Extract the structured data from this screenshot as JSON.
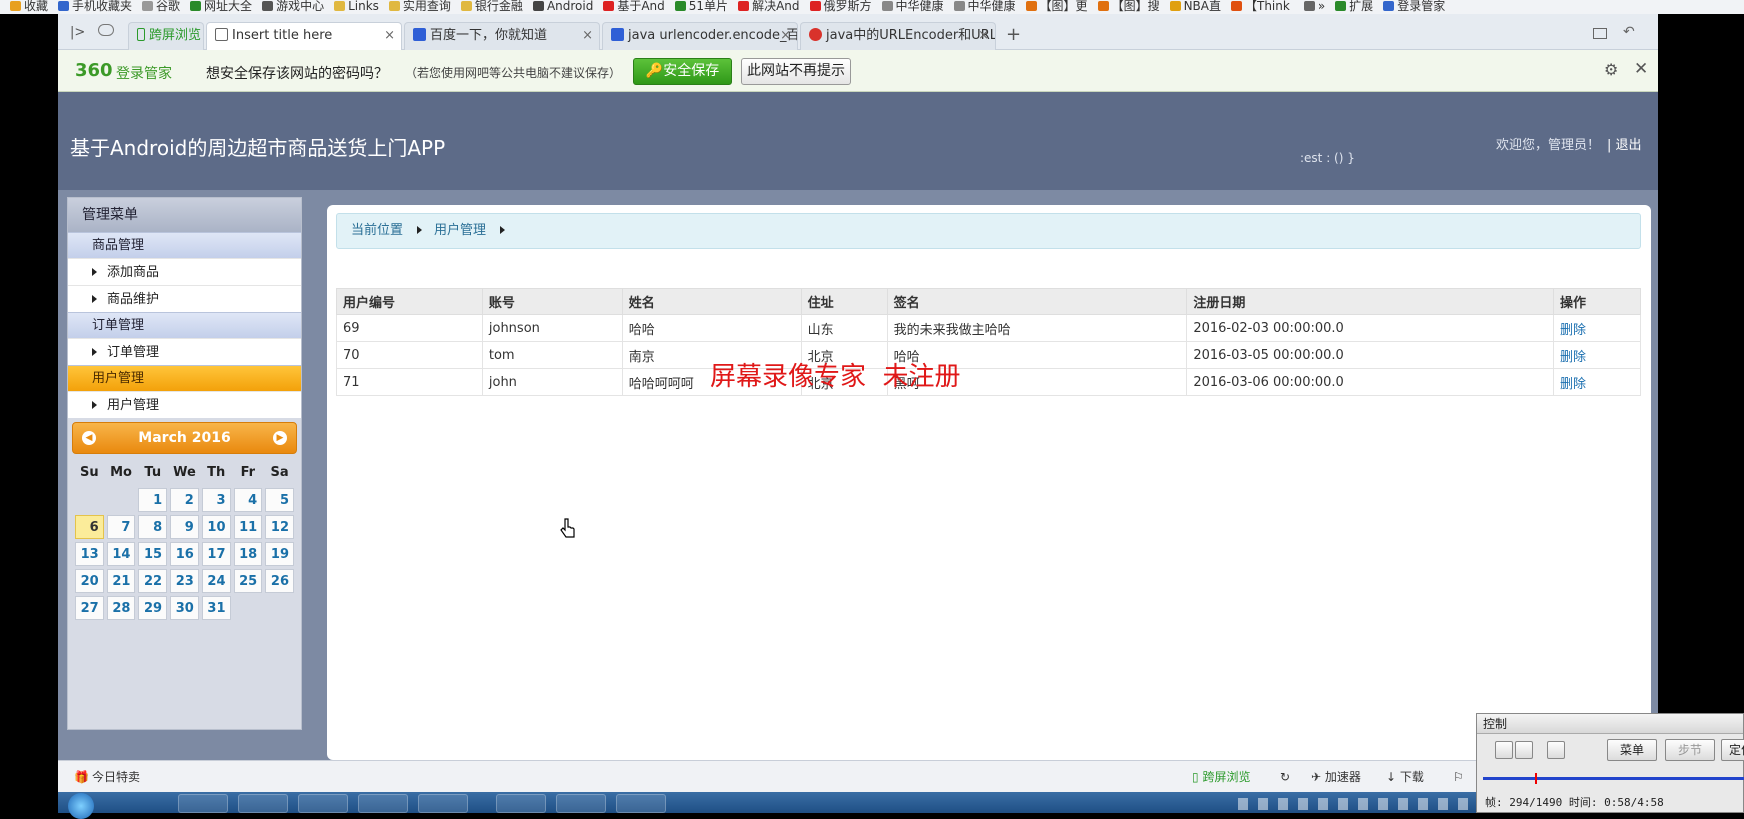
{
  "bookmarks": [
    "收藏",
    "手机收藏夹",
    "谷歌",
    "网址大全",
    "游戏中心",
    "Links",
    "实用查询",
    "银行金融",
    "Android",
    "基于And",
    "51单片",
    "解决And",
    "俄罗斯方",
    "中华健康",
    "中华健康",
    "【图】更",
    "【图】搜",
    "NBA直",
    "【Think",
    "»",
    "扩展",
    "登录管家"
  ],
  "tabs": [
    {
      "label": "跨屏浏览"
    },
    {
      "label": "Insert title here",
      "close": "×"
    },
    {
      "label": "百度一下，你就知道",
      "close": "×"
    },
    {
      "label": "java urlencoder.encode_百度",
      "close": "×"
    },
    {
      "label": "java中的URLEncoder和URLD",
      "close": "×"
    }
  ],
  "new_tab": "+",
  "password_bar": {
    "brand": "360",
    "brand_suffix": "登录管家",
    "prompt": "想安全保存该网站的密码吗？",
    "hint": "（若您使用网吧等公共电脑不建议保存）",
    "save_label": "安全保存",
    "never_label": "此网站不再提示"
  },
  "app": {
    "title": "基于Android的周边超市商品送货上门APP",
    "welcome": "欢迎您，管理员！",
    "logout": "| 退出",
    "debug_text": ":est : () }"
  },
  "menu": {
    "title": "管理菜单",
    "groups": [
      {
        "label": "商品管理",
        "items": [
          "添加商品",
          "商品维护"
        ]
      },
      {
        "label": "订单管理",
        "items": [
          "订单管理"
        ]
      },
      {
        "label": "用户管理",
        "items": [
          "用户管理"
        ]
      }
    ]
  },
  "calendar": {
    "title": "March 2016",
    "weekdays": [
      "Su",
      "Mo",
      "Tu",
      "We",
      "Th",
      "Fr",
      "Sa"
    ],
    "today": 6,
    "weeks": [
      [
        "",
        "",
        1,
        2,
        3,
        4,
        5
      ],
      [
        6,
        7,
        8,
        9,
        10,
        11,
        12
      ],
      [
        13,
        14,
        15,
        16,
        17,
        18,
        19
      ],
      [
        20,
        21,
        22,
        23,
        24,
        25,
        26
      ],
      [
        27,
        28,
        29,
        30,
        31,
        "",
        ""
      ]
    ]
  },
  "breadcrumb": [
    "当前位置",
    "用户管理"
  ],
  "table": {
    "headers": [
      "用户编号",
      "账号",
      "姓名",
      "住址",
      "签名",
      "注册日期",
      "操作"
    ],
    "rows": [
      [
        "69",
        "johnson",
        "哈哈",
        "山东",
        "我的未来我做主哈哈",
        "2016-02-03 00:00:00.0",
        "删除"
      ],
      [
        "70",
        "tom",
        "南京",
        "北京",
        "哈哈",
        "2016-03-05 00:00:00.0",
        "删除"
      ],
      [
        "71",
        "john",
        "哈哈呵呵呵",
        "北京",
        "黑呵",
        "2016-03-06 00:00:00.0",
        "删除"
      ]
    ]
  },
  "watermark": "屏幕录像专家  未注册",
  "statusbar": {
    "today_deals": "今日特卖",
    "cross_screen": "跨屏浏览",
    "accelerator": "加速器",
    "download": "下载"
  },
  "recorder": {
    "title": "控制",
    "menu_label": "菜单",
    "step_label": "步节",
    "locate_label": "定位",
    "status": "帧: 294/1490 时间: 0:58/4:58"
  }
}
